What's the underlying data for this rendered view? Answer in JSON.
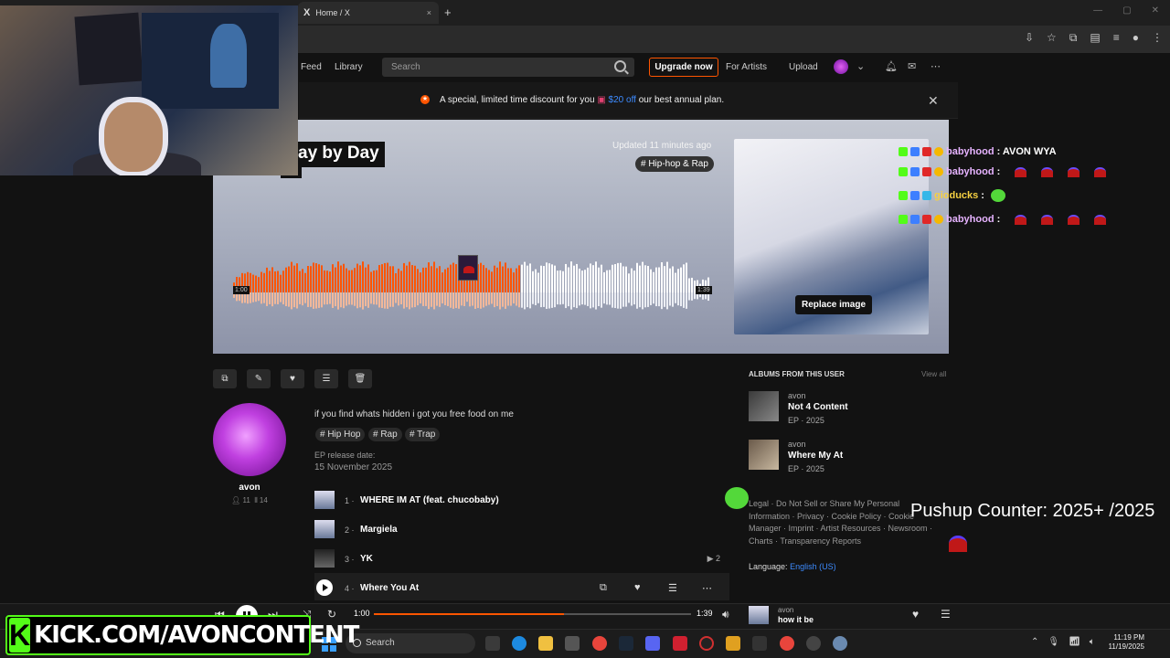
{
  "browser": {
    "tab_title": "Home / X",
    "tab_icon": "X",
    "close_glyph": "×",
    "new_tab_glyph": "+"
  },
  "header": {
    "nav_feed": "Feed",
    "nav_library": "Library",
    "search_placeholder": "Search",
    "upgrade": "Upgrade now",
    "for_artists": "For Artists",
    "upload": "Upload"
  },
  "banner": {
    "text_before": "A special, limited time discount for you",
    "highlight": "$20 off",
    "text_after": "our best annual plan."
  },
  "hero": {
    "title": "ay by Day",
    "artist": "on",
    "updated": "Updated 11 minutes ago",
    "tag": "# Hip-hop & Rap",
    "wave_start": "1:00",
    "wave_end": "1:39",
    "progress": 0.6,
    "replace_image": "Replace image"
  },
  "chat": [
    {
      "user": "babyhood",
      "user_color": "#e6b3ff",
      "message": ": AVON WYA"
    },
    {
      "user": "babyhood",
      "user_color": "#e6b3ff",
      "message": ":"
    },
    {
      "user": "gioducks",
      "user_color": "#f5d042",
      "message": ":"
    },
    {
      "user": "babyhood",
      "user_color": "#e6b3ff",
      "message": ":"
    }
  ],
  "profile": {
    "name": "avon",
    "followers": "11",
    "tracks": "14",
    "description": "if you find whats hidden i got you free food on me",
    "tags": [
      "# Hip Hop",
      "# Rap",
      "# Trap"
    ],
    "release_label": "EP release date:",
    "release_date": "15 November 2025"
  },
  "tracks": [
    {
      "num": "1 ·",
      "title": "WHERE IM AT (feat. chucobaby)"
    },
    {
      "num": "2 ·",
      "title": "Margiela"
    },
    {
      "num": "3 ·",
      "title": "YK",
      "plays": "▶ 2"
    },
    {
      "num": "4 ·",
      "title": "Where You At"
    }
  ],
  "albums": {
    "title": "ALBUMS FROM THIS USER",
    "view_all": "View all",
    "items": [
      {
        "artist": "avon",
        "name": "Not 4 Content",
        "meta": "EP · 2025"
      },
      {
        "artist": "avon",
        "name": "Where My At",
        "meta": "EP · 2025"
      }
    ]
  },
  "legal": "Legal · Do Not Sell or Share My Personal Information · Privacy · Cookie Policy · Cookie Manager · Imprint · Artist Resources · Newsroom · Charts · Transparency Reports",
  "language": {
    "label": "Language:",
    "value": "English (US)"
  },
  "overlay": {
    "pushup": "Pushup Counter: 2025+ /2025",
    "kick_logo": "K",
    "kick_url": "KICK.COM/AVONCONTENT"
  },
  "player": {
    "current": "1:00",
    "duration": "1:39",
    "progress": 0.6,
    "artist": "avon",
    "title": "how it be"
  },
  "taskbar": {
    "search": "Search",
    "time": "11:19 PM",
    "date": "11/19/2025"
  },
  "colors": {
    "accent": "#ff5500",
    "link": "#3d8bff",
    "kick": "#53fc18"
  }
}
